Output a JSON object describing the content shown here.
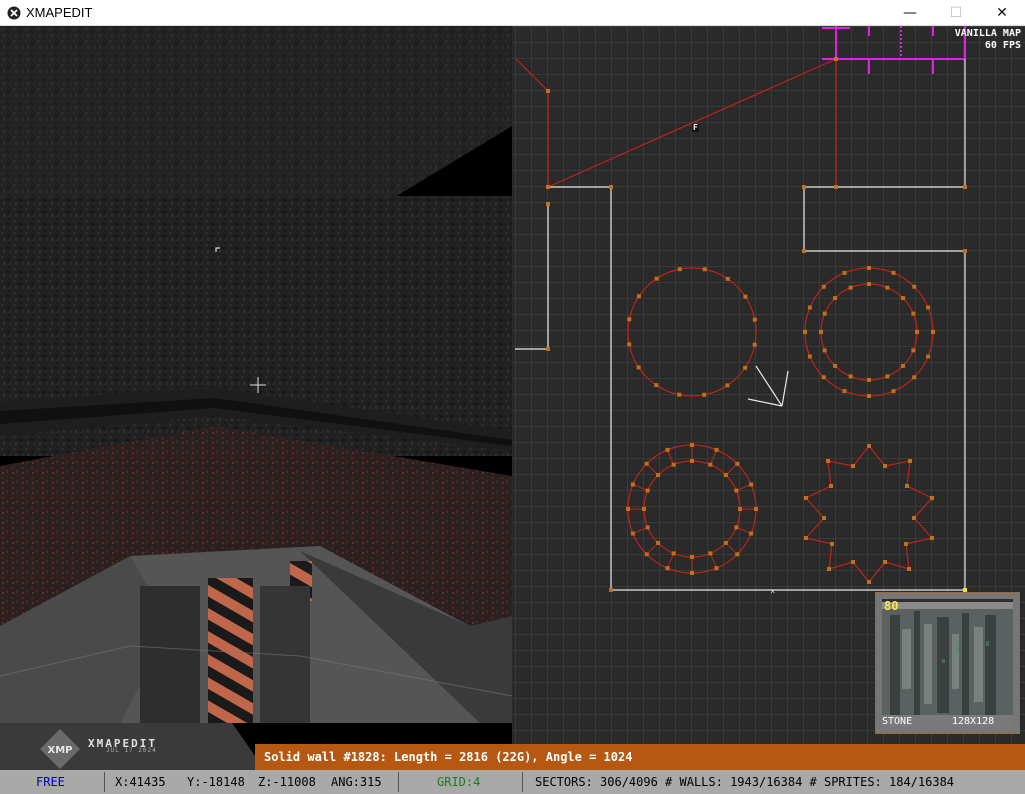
{
  "window": {
    "title": "XMAPEDIT",
    "minimize": "—",
    "maximize": "☐",
    "close": "✕",
    "icon": "xmp-app-icon"
  },
  "map": {
    "mode_label": "VANILLA MAP",
    "fps_label": "60 FPS",
    "sector_marker": "F",
    "vertex_color": "#c0701a",
    "red_wall_color": "#c0231a",
    "white_wall_color": "#e8e8e8",
    "highlight_color": "#e020e0"
  },
  "texture": {
    "number": "80",
    "name": "STONE",
    "size": "128X128"
  },
  "logo": {
    "badge": "XMP",
    "name": "XMAPEDIT",
    "date": "JUL 17 2024"
  },
  "status_line": "Solid wall #1828: Length = 2816 (22G), Angle = 1024",
  "bottombar": {
    "mode": "FREE",
    "x": "X:41435",
    "y": "Y:-18148",
    "z": "Z:-11008",
    "ang": "ANG:315",
    "grid": "GRID:4",
    "stats": "SECTORS: 306/4096 # WALLS: 1943/16384 # SPRITES: 184/16384"
  }
}
